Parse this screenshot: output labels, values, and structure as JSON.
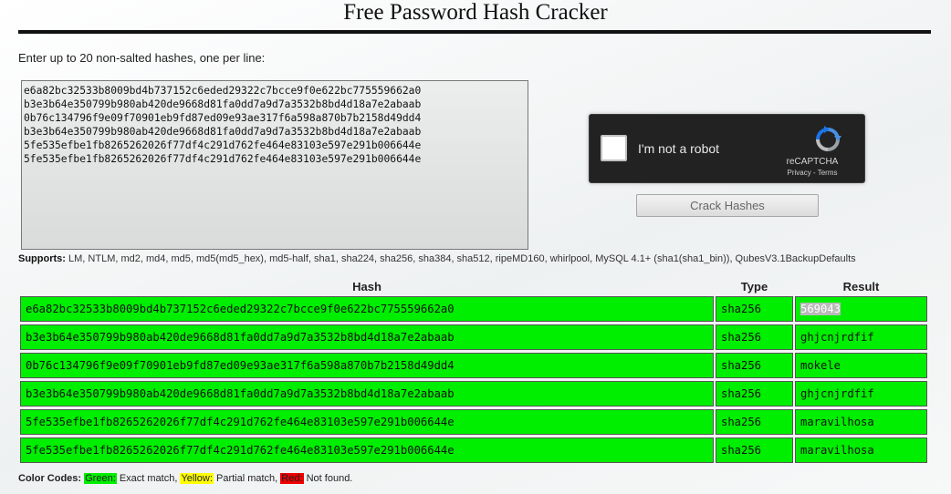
{
  "header": {
    "title": "Free Password Hash Cracker"
  },
  "form": {
    "instructions": "Enter up to 20 non-salted hashes, one per line:",
    "hashes_text": "e6a82bc32533b8009bd4b737152c6eded29322c7bcce9f0e622bc775559662a0\nb3e3b64e350799b980ab420de9668d81fa0dd7a9d7a3532b8bd4d18a7e2abaab\n0b76c134796f9e09f70901eb9fd87ed09e93ae317f6a598a870b7b2158d49dd4\nb3e3b64e350799b980ab420de9668d81fa0dd7a9d7a3532b8bd4d18a7e2abaab\n5fe535efbe1fb8265262026f77df4c291d762fe464e83103e597e291b006644e\n5fe535efbe1fb8265262026f77df4c291d762fe464e83103e597e291b006644e",
    "crack_button": "Crack Hashes"
  },
  "recaptcha": {
    "label": "I'm not a robot",
    "brand": "reCAPTCHA",
    "terms": "Privacy - Terms"
  },
  "supports": {
    "label": "Supports:",
    "text": "LM, NTLM, md2, md4, md5, md5(md5_hex), md5-half, sha1, sha224, sha256, sha384, sha512, ripeMD160, whirlpool, MySQL 4.1+ (sha1(sha1_bin)), QubesV3.1BackupDefaults"
  },
  "results": {
    "columns": {
      "hash": "Hash",
      "type": "Type",
      "result": "Result"
    },
    "rows": [
      {
        "hash": "e6a82bc32533b8009bd4b737152c6eded29322c7bcce9f0e622bc775559662a0",
        "type": "sha256",
        "result": "569043",
        "status": "green"
      },
      {
        "hash": "b3e3b64e350799b980ab420de9668d81fa0dd7a9d7a3532b8bd4d18a7e2abaab",
        "type": "sha256",
        "result": "ghjcnjrdfif",
        "status": "green"
      },
      {
        "hash": "0b76c134796f9e09f70901eb9fd87ed09e93ae317f6a598a870b7b2158d49dd4",
        "type": "sha256",
        "result": "mokele",
        "status": "green"
      },
      {
        "hash": "b3e3b64e350799b980ab420de9668d81fa0dd7a9d7a3532b8bd4d18a7e2abaab",
        "type": "sha256",
        "result": "ghjcnjrdfif",
        "status": "green"
      },
      {
        "hash": "5fe535efbe1fb8265262026f77df4c291d762fe464e83103e597e291b006644e",
        "type": "sha256",
        "result": "maravilhosa",
        "status": "green"
      },
      {
        "hash": "5fe535efbe1fb8265262026f77df4c291d762fe464e83103e597e291b006644e",
        "type": "sha256",
        "result": "maravilhosa",
        "status": "green"
      }
    ]
  },
  "legend": {
    "label": "Color Codes:",
    "green": {
      "name": "Green:",
      "desc": "Exact match,",
      "color": "#00ee00"
    },
    "yellow": {
      "name": "Yellow:",
      "desc": "Partial match,",
      "color": "#ffff00"
    },
    "red": {
      "name": "Red:",
      "desc": "Not found.",
      "color": "#ee0000"
    }
  },
  "colors": {
    "match_green": "#00ee00",
    "recaptcha_blue": "#4a90e2"
  }
}
